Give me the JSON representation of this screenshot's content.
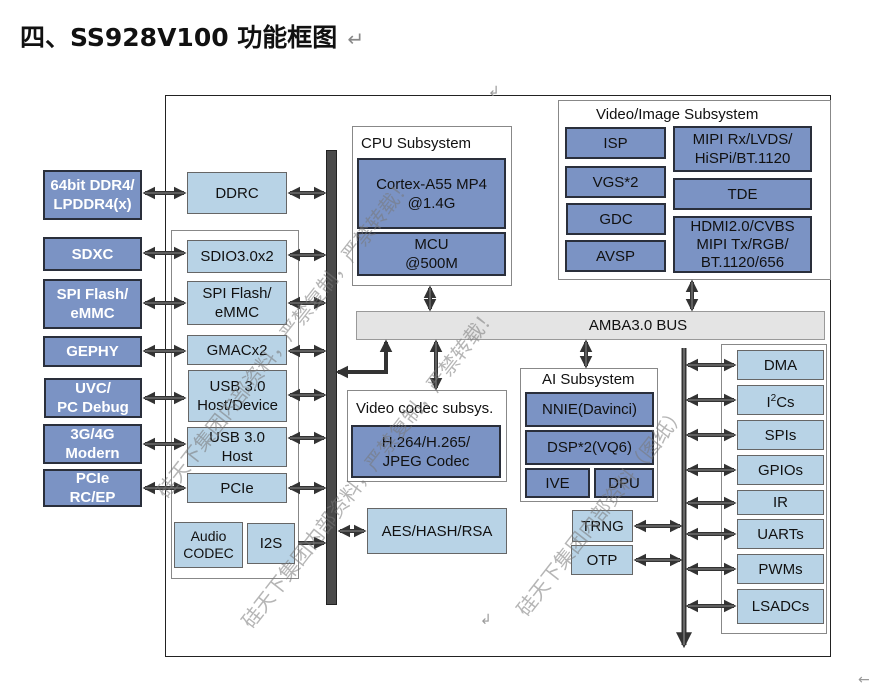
{
  "title": "四、SS928V100 功能框图",
  "return_mark": "↵",
  "external_interfaces": [
    {
      "id": "ddr",
      "label": "64bit DDR4/\nLPDDR4(x)"
    },
    {
      "id": "sdxc",
      "label": "SDXC"
    },
    {
      "id": "spi-flash",
      "label": "SPI Flash/\neMMC"
    },
    {
      "id": "gephy",
      "label": "GEPHY"
    },
    {
      "id": "uvc",
      "label": "UVC/\nPC Debug"
    },
    {
      "id": "modem",
      "label": "3G/4G\nModern"
    },
    {
      "id": "pcie-ext",
      "label": "PCIe\nRC/EP"
    }
  ],
  "left_controllers": {
    "ddrc": "DDRC",
    "items": [
      {
        "id": "sdio",
        "label": "SDIO3.0x2"
      },
      {
        "id": "spi-flash-ctrl",
        "label": "SPI Flash/\neMMC"
      },
      {
        "id": "gmac",
        "label": "GMACx2"
      },
      {
        "id": "usb-host-device",
        "label": "USB 3.0\nHost/Device"
      },
      {
        "id": "usb-host",
        "label": "USB 3.0\nHost"
      },
      {
        "id": "pcie",
        "label": "PCIe"
      }
    ],
    "audio_codec": "Audio\nCODEC",
    "i2s": "I2S"
  },
  "cpu_subsystem": {
    "label": "CPU Subsystem",
    "cores": "Cortex-A55 MP4\n@1.4G",
    "mcu": "MCU\n@500M"
  },
  "video_image_subsystem": {
    "label": "Video/Image Subsystem",
    "left": [
      "ISP",
      "VGS*2",
      "GDC",
      "AVSP"
    ],
    "right": [
      "MIPI Rx/LVDS/\nHiSPi/BT.1120",
      "TDE",
      "HDMI2.0/CVBS\nMIPI Tx/RGB/\nBT.1120/656"
    ]
  },
  "bus": {
    "label": "AMBA3.0 BUS"
  },
  "video_codec_subsystem": {
    "label": "Video codec subsys.",
    "codec": "H.264/H.265/\nJPEG Codec"
  },
  "ai_subsystem": {
    "label": "AI Subsystem",
    "nnie": "NNIE(Davinci)",
    "dsp": "DSP*2(VQ6)",
    "ive": "IVE",
    "dpu": "DPU"
  },
  "security": {
    "aes": "AES/HASH/RSA",
    "trng": "TRNG",
    "otp": "OTP"
  },
  "peripherals": [
    "DMA",
    "I2Cs",
    "SPIs",
    "GPIOs",
    "IR",
    "UARTs",
    "PWMs",
    "LSADCs"
  ],
  "watermarks": [
    "硅天下集团内部资料，严禁复制，严禁转载！",
    "严禁复制，严禁转载！",
    "硅天下集团内部资料（图纸）"
  ],
  "colors": {
    "external_block": "#7b93c4",
    "internal_block": "#b8d3e6",
    "bus": "#e4e4e4",
    "backbone": "#4a4a4a"
  }
}
